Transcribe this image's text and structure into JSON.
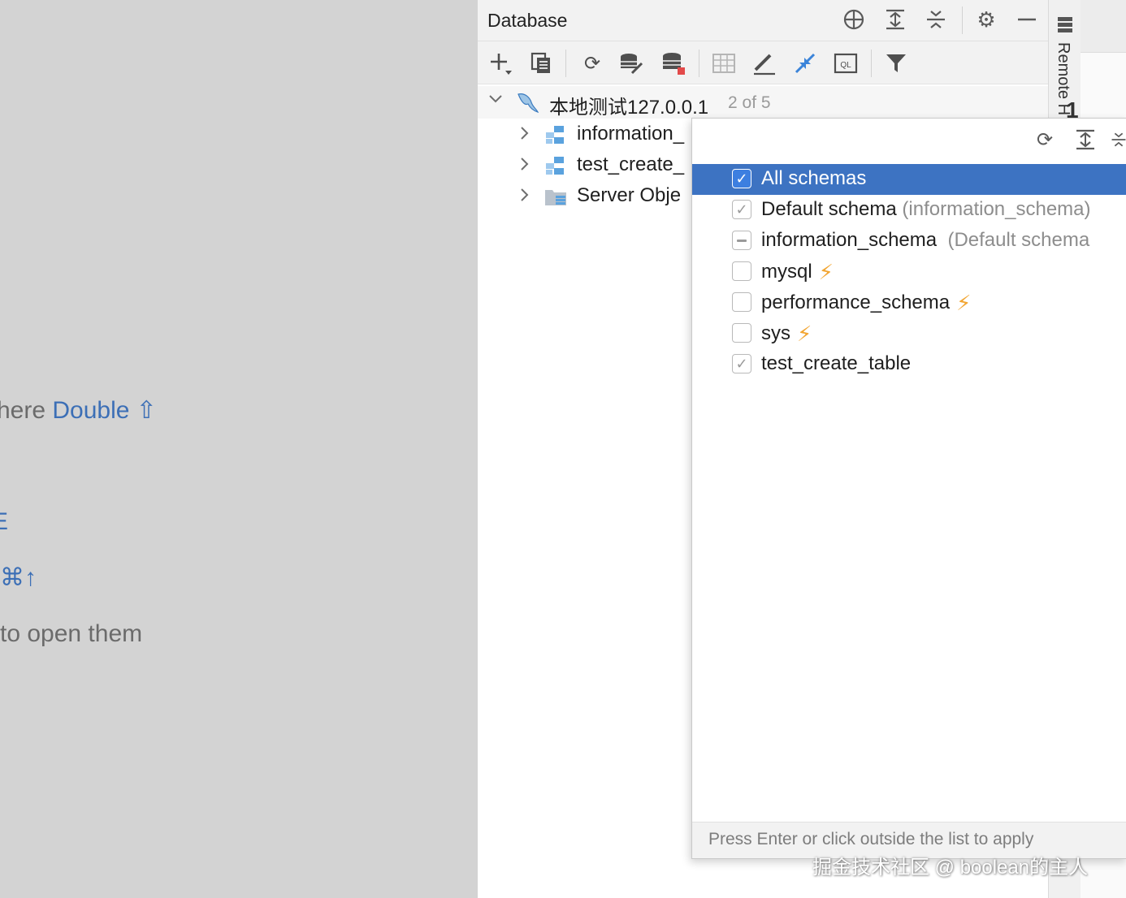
{
  "editor_hints": {
    "line1_text": "here ",
    "line1_key": "Double ⇧",
    "line2_key": ")",
    "line3_key": "E",
    "line4_key": "⌘↑",
    "line5_text": "to open them"
  },
  "database_panel": {
    "title": "Database",
    "root": {
      "label": "本地测试127.0.0.1",
      "count": "2 of 5"
    },
    "tree_items": [
      {
        "label": "information_"
      },
      {
        "label": "test_create_"
      },
      {
        "label": "Server Obje"
      }
    ]
  },
  "side_strip": {
    "label": "Remote H",
    "peek_text": "1"
  },
  "schema_popup": {
    "items": [
      {
        "label": "All schemas",
        "note": "",
        "state": "checked",
        "bolt": false,
        "selected": true
      },
      {
        "label": "Default schema",
        "note": "(information_schema)",
        "state": "checked-gray",
        "bolt": false,
        "selected": false
      },
      {
        "label": "information_schema",
        "note": "(Default schema",
        "state": "partial",
        "bolt": false,
        "selected": false
      },
      {
        "label": "mysql",
        "note": "",
        "state": "unchecked",
        "bolt": true,
        "selected": false
      },
      {
        "label": "performance_schema",
        "note": "",
        "state": "unchecked",
        "bolt": true,
        "selected": false
      },
      {
        "label": "sys",
        "note": "",
        "state": "unchecked",
        "bolt": true,
        "selected": false
      },
      {
        "label": "test_create_table",
        "note": "",
        "state": "checked-gray",
        "bolt": false,
        "selected": false
      }
    ],
    "footer": "Press Enter or click outside the list to apply"
  },
  "watermark": "掘金技术社区 @ boolean的主人",
  "colors": {
    "selection": "#3d73c2",
    "accent_key": "#3c6fb6",
    "bolt": "#f2a531",
    "checkbox_active": "#3d7fe0"
  }
}
